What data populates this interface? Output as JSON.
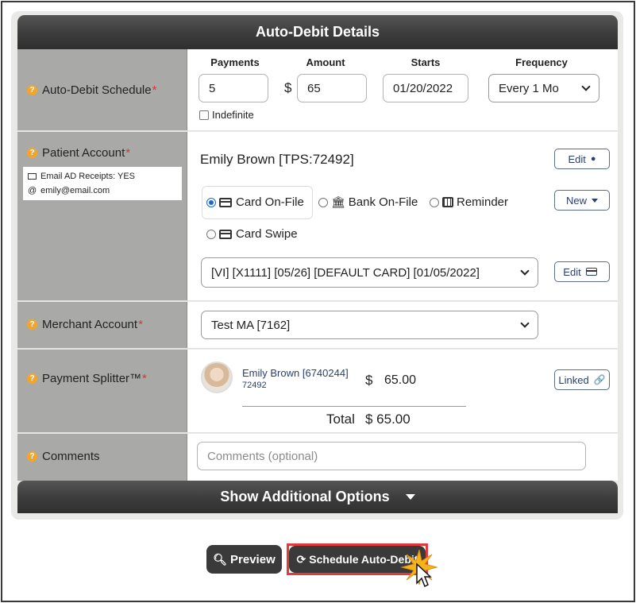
{
  "header": {
    "title": "Auto-Debit Details"
  },
  "schedule": {
    "label": "Auto-Debit Schedule",
    "required_mark": "*",
    "payments_label": "Payments",
    "payments_value": "5",
    "amount_label": "Amount",
    "currency_symbol": "$",
    "amount_value": "65",
    "starts_label": "Starts",
    "starts_value": "01/20/2022",
    "frequency_label": "Frequency",
    "frequency_value": "Every 1 Mo",
    "indefinite_label": "Indefinite",
    "indefinite_checked": false
  },
  "patient": {
    "label": "Patient Account",
    "required_mark": "*",
    "email_receipts": "Email AD Receipts: YES",
    "email": "emily@email.com",
    "name": "Emily Brown [TPS:72492]",
    "edit_label": "Edit",
    "new_label": "New",
    "options": [
      "Card On-File",
      "Bank On-File",
      "Reminder",
      "Card Swipe"
    ],
    "selected_option": "Card On-File",
    "card_value": "[VI] [X1111] [05/26] [DEFAULT CARD] [01/05/2022]",
    "card_edit_label": "Edit"
  },
  "merchant": {
    "label": "Merchant Account",
    "required_mark": "*",
    "value": "Test MA [7162]"
  },
  "splitter": {
    "label": "Payment Splitter™",
    "required_mark": "*",
    "person_name": "Emily Brown [6740244]",
    "person_id": "72492",
    "currency_symbol": "$",
    "amount": "65.00",
    "linked_label": "Linked",
    "total_label": "Total",
    "total_value": "$ 65.00"
  },
  "comments": {
    "label": "Comments",
    "placeholder": "Comments (optional)"
  },
  "footer": {
    "show_options_label": "Show Additional Options"
  },
  "actions": {
    "preview_label": "Preview",
    "schedule_label": "Schedule Auto-Debit"
  },
  "colors": {
    "header_bg": "#3c3c3c",
    "label_bg": "#a9a9a7",
    "help_icon": "#f2a52b",
    "required": "#e0322d",
    "link_blue": "#2a3f6e",
    "highlight": "#e03a3a"
  }
}
